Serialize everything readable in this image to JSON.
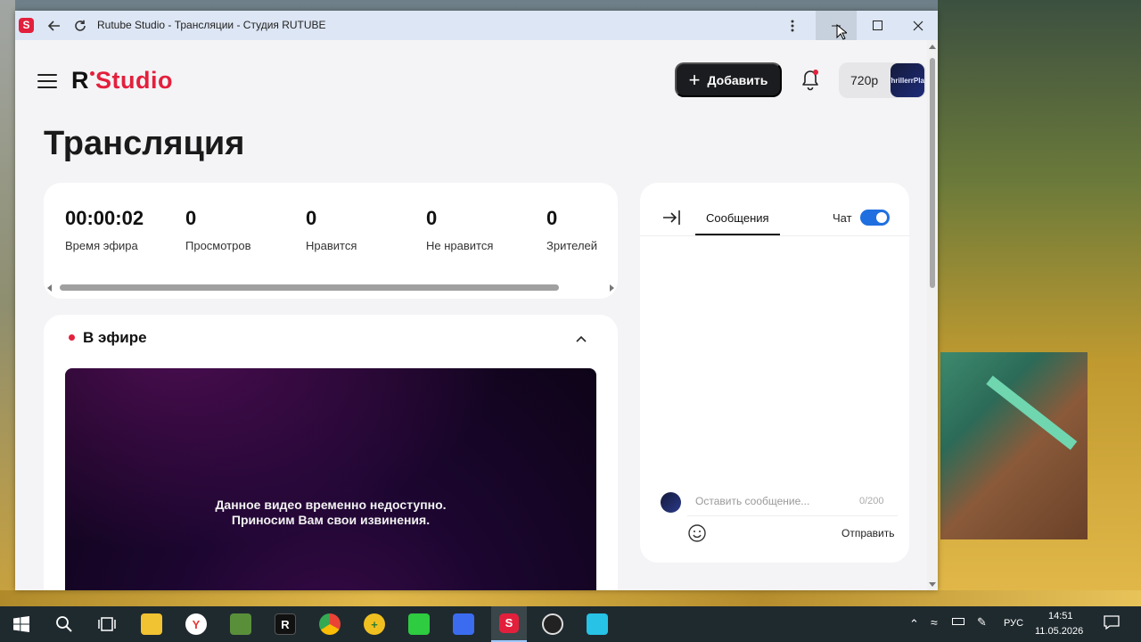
{
  "browser": {
    "title": "Rutube Studio - Трансляции - Студия RUTUBE",
    "app_icon_letter": "S",
    "menu_icon": "more-vertical-icon",
    "minimize_icon": "minimize-icon",
    "maximize_icon": "maximize-icon",
    "close_icon": "close-icon"
  },
  "header": {
    "logo_r": "R",
    "logo_studio": "Studio",
    "add_button": "Добавить",
    "quality": "720p",
    "avatar_text": "ThrillerrPlay"
  },
  "page": {
    "title": "Трансляция"
  },
  "stats": [
    {
      "value": "00:00:02",
      "label": "Время эфира"
    },
    {
      "value": "0",
      "label": "Просмотров"
    },
    {
      "value": "0",
      "label": "Нравится"
    },
    {
      "value": "0",
      "label": "Не нравится"
    },
    {
      "value": "0",
      "label": "Зрителей"
    }
  ],
  "live": {
    "title": "В эфире",
    "player_message_line1": "Данное видео временно недоступно.",
    "player_message_line2": "Приносим Вам свои извинения."
  },
  "chat": {
    "tab_messages": "Сообщения",
    "chat_label": "Чат",
    "chat_enabled": true,
    "input_placeholder": "Оставить сообщение...",
    "counter": "0/200",
    "send_label": "Отправить"
  },
  "taskbar": {
    "language": "РУС",
    "time": "14:51",
    "date": "11.05.2026"
  },
  "colors": {
    "brand_red": "#e3203c",
    "toggle_blue": "#1f6fe0",
    "titlebar": "#dde6f4"
  }
}
